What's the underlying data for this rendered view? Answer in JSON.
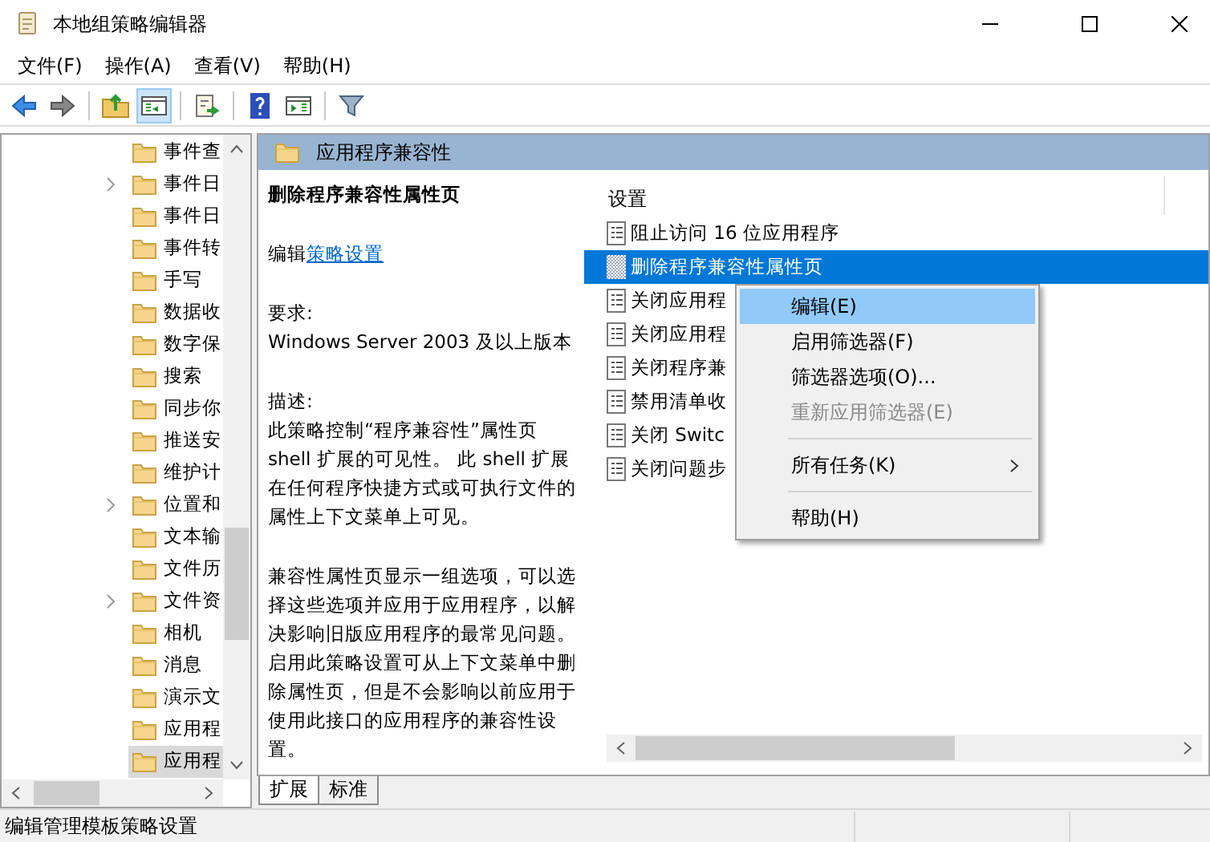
{
  "window": {
    "title": "本地组策略编辑器"
  },
  "menu": [
    "文件(F)",
    "操作(A)",
    "查看(V)",
    "帮助(H)"
  ],
  "toolbar": [
    {
      "kind": "back",
      "selected": false
    },
    {
      "kind": "forward",
      "selected": false
    },
    {
      "kind": "up",
      "selected": false
    },
    {
      "kind": "tree",
      "selected": true
    },
    {
      "kind": "export",
      "selected": false
    },
    {
      "kind": "help",
      "selected": false
    },
    {
      "kind": "pane",
      "selected": false
    },
    {
      "kind": "filter",
      "selected": false
    }
  ],
  "tree": [
    {
      "label": "事件查",
      "expandable": false,
      "selected": false
    },
    {
      "label": "事件日",
      "expandable": true,
      "selected": false
    },
    {
      "label": "事件日",
      "expandable": false,
      "selected": false
    },
    {
      "label": "事件转",
      "expandable": false,
      "selected": false
    },
    {
      "label": "手写",
      "expandable": false,
      "selected": false
    },
    {
      "label": "数据收",
      "expandable": false,
      "selected": false
    },
    {
      "label": "数字保",
      "expandable": false,
      "selected": false
    },
    {
      "label": "搜索",
      "expandable": false,
      "selected": false
    },
    {
      "label": "同步你",
      "expandable": false,
      "selected": false
    },
    {
      "label": "推送安",
      "expandable": false,
      "selected": false
    },
    {
      "label": "维护计",
      "expandable": false,
      "selected": false
    },
    {
      "label": "位置和",
      "expandable": true,
      "selected": false
    },
    {
      "label": "文本输",
      "expandable": false,
      "selected": false
    },
    {
      "label": "文件历",
      "expandable": false,
      "selected": false
    },
    {
      "label": "文件资",
      "expandable": true,
      "selected": false
    },
    {
      "label": "相机",
      "expandable": false,
      "selected": false
    },
    {
      "label": "消息",
      "expandable": false,
      "selected": false
    },
    {
      "label": "演示文",
      "expandable": false,
      "selected": false
    },
    {
      "label": "应用程",
      "expandable": false,
      "selected": false
    },
    {
      "label": "应用程",
      "expandable": false,
      "selected": true
    }
  ],
  "header": "应用程序兼容性",
  "description": {
    "title": "删除程序兼容性属性页",
    "edit_prefix": "编辑",
    "edit_link": "策略设置",
    "requirements_label": "要求:",
    "requirements": "Windows Server 2003 及以上版本",
    "description_label": "描述:",
    "paragraphs": [
      "此策略控制“程序兼容性”属性页 shell 扩展的可见性。 此 shell 扩展在任何程序快捷方式或可执行文件的属性上下文菜单上可见。",
      "兼容性属性页显示一组选项，可以选择这些选项并应用于应用程序，以解决影响旧版应用程序的最常见问题。启用此策略设置可从上下文菜单中删除属性页，但是不会影响以前应用于使用此接口的应用程序的兼容性设置。"
    ]
  },
  "settings": {
    "column": "设置",
    "rows": [
      {
        "label": "阻止访问 16 位应用程序",
        "selected": false
      },
      {
        "label": "删除程序兼容性属性页",
        "selected": true
      },
      {
        "label": "关闭应用程",
        "selected": false
      },
      {
        "label": "关闭应用程",
        "selected": false
      },
      {
        "label": "关闭程序兼",
        "selected": false
      },
      {
        "label": "禁用清单收",
        "selected": false
      },
      {
        "label": "关闭 Switc",
        "selected": false
      },
      {
        "label": "关闭问题步",
        "selected": false
      }
    ]
  },
  "context_menu": [
    {
      "kind": "item",
      "label": "编辑(E)",
      "selected": true,
      "disabled": false,
      "submenu": false
    },
    {
      "kind": "item",
      "label": "启用筛选器(F)",
      "selected": false,
      "disabled": false,
      "submenu": false
    },
    {
      "kind": "item",
      "label": "筛选器选项(O)...",
      "selected": false,
      "disabled": false,
      "submenu": false
    },
    {
      "kind": "item",
      "label": "重新应用筛选器(E)",
      "selected": false,
      "disabled": true,
      "submenu": false
    },
    {
      "kind": "separator"
    },
    {
      "kind": "item",
      "label": "所有任务(K)",
      "selected": false,
      "disabled": false,
      "submenu": true
    },
    {
      "kind": "separator"
    },
    {
      "kind": "item",
      "label": "帮助(H)",
      "selected": false,
      "disabled": false,
      "submenu": false
    }
  ],
  "tabs": [
    {
      "label": "扩展",
      "selected": true
    },
    {
      "label": "标准",
      "selected": false
    }
  ],
  "status_bar": "编辑管理模板策略设置"
}
